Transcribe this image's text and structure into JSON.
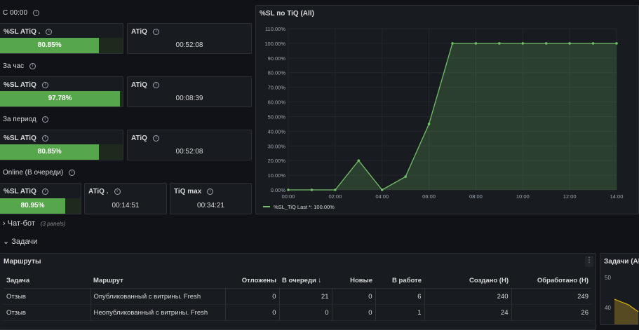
{
  "stats": {
    "s1": {
      "label": "С 00:00",
      "sl_title": "%SL ATiQ .",
      "sl_value": "80.85%",
      "sl_fraction": 0.8085,
      "atiq_title": "ATiQ",
      "atiq_value": "00:52:08"
    },
    "s2": {
      "label": "За час",
      "sl_title": "%SL ATiQ",
      "sl_value": "97.78%",
      "sl_fraction": 0.9778,
      "atiq_title": "ATiQ",
      "atiq_value": "00:08:39"
    },
    "s3": {
      "label": "За период",
      "sl_title": "%SL ATiQ",
      "sl_value": "80.85%",
      "sl_fraction": 0.8085,
      "atiq_title": "ATiQ",
      "atiq_value": "00:52:08"
    },
    "s4": {
      "label": "Online (В очереди)",
      "sl_title": "%SL ATiQ",
      "sl_value": "80.95%",
      "sl_fraction": 0.8095,
      "atiq_title": "ATiQ .",
      "atiq_value": "00:14:51",
      "tiq_title": "TiQ max",
      "tiq_value": "00:34:21"
    }
  },
  "chart_panel": {
    "title": "%SL по TiQ (All)"
  },
  "chart_data": {
    "type": "area",
    "title": "%SL по TiQ (All)",
    "x": [
      "00:00",
      "01:00",
      "02:00",
      "03:00",
      "04:00",
      "05:00",
      "06:00",
      "07:00",
      "08:00",
      "09:00",
      "10:00",
      "11:00",
      "12:00",
      "13:00",
      "14:00"
    ],
    "x_ticks": [
      "00:00",
      "02:00",
      "04:00",
      "06:00",
      "08:00",
      "10:00",
      "12:00",
      "14:00"
    ],
    "y_ticks": [
      "0.00%",
      "10.00%",
      "20.00%",
      "30.00%",
      "40.00%",
      "50.00%",
      "60.00%",
      "70.00%",
      "80.00%",
      "90.00%",
      "100.00%",
      "110.00%"
    ],
    "ylim": [
      0,
      110
    ],
    "series": [
      {
        "name": "%SL_TiQ",
        "values": [
          0,
          0,
          0,
          20,
          0,
          9,
          45,
          100,
          100,
          100,
          100,
          100,
          100,
          100,
          100
        ],
        "color": "#73bf69"
      }
    ],
    "legend": {
      "text": "%SL_TiQ  Last *: 100.00%",
      "position": "bottom-left"
    },
    "grid": true
  },
  "sections": {
    "chatbot": {
      "label": "Чат-бот",
      "note": "(3 panels)"
    },
    "tasks": {
      "label": "Задачи"
    }
  },
  "routes_panel": {
    "title": "Маршруты",
    "columns": [
      "Задача",
      "Маршрут",
      "Отложены",
      "В очереди",
      "Новые",
      "В работе",
      "Создано (Н)",
      "Обработано (Н)"
    ],
    "sort_icon": "↓",
    "rows": [
      [
        "Отзыв",
        "Опубликованный с витрины. Fresh",
        "0",
        "21",
        "0",
        "6",
        "240",
        "249"
      ],
      [
        "Отзыв",
        "Неопубликованный с витрины. Fresh",
        "0",
        "0",
        "0",
        "1",
        "24",
        "26"
      ]
    ]
  },
  "tasks_panel": {
    "title": "Задачи (All)",
    "y_labels": [
      "50",
      "40"
    ]
  },
  "colors": {
    "background": "#111217",
    "panel": "#181b1f",
    "accent_green": "#56a64b",
    "line": "#73bf69"
  }
}
